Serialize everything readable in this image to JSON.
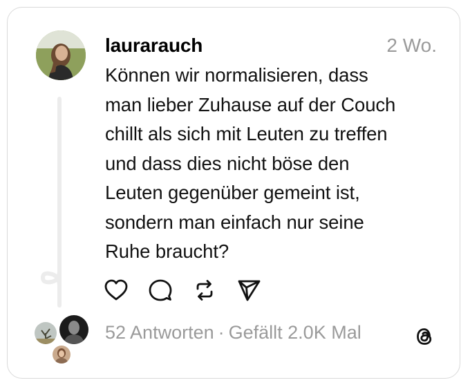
{
  "post": {
    "username": "laurarauch",
    "timestamp": "2 Wo.",
    "text": "Können wir normalisieren, dass\nman lieber Zuhause auf der Couch\nchillt als sich mit Leuten zu treffen\nund dass dies nicht böse den\nLeuten gegenüber gemeint ist,\nsondern man einfach nur seine\nRuhe braucht?"
  },
  "actions": [
    {
      "name": "like",
      "icon": "heart-icon"
    },
    {
      "name": "reply",
      "icon": "comment-bubble-icon"
    },
    {
      "name": "repost",
      "icon": "repost-icon"
    },
    {
      "name": "share",
      "icon": "send-icon"
    }
  ],
  "stats": {
    "replies": "52 Antworten",
    "separator": "·",
    "likes": "Gefällt 2.0K Mal"
  },
  "branding": {
    "logo": "threads-logo-icon"
  },
  "colors": {
    "text": "#111111",
    "muted": "#9a9a9a",
    "border": "#d9d9d9",
    "thread_line": "#ececec"
  }
}
